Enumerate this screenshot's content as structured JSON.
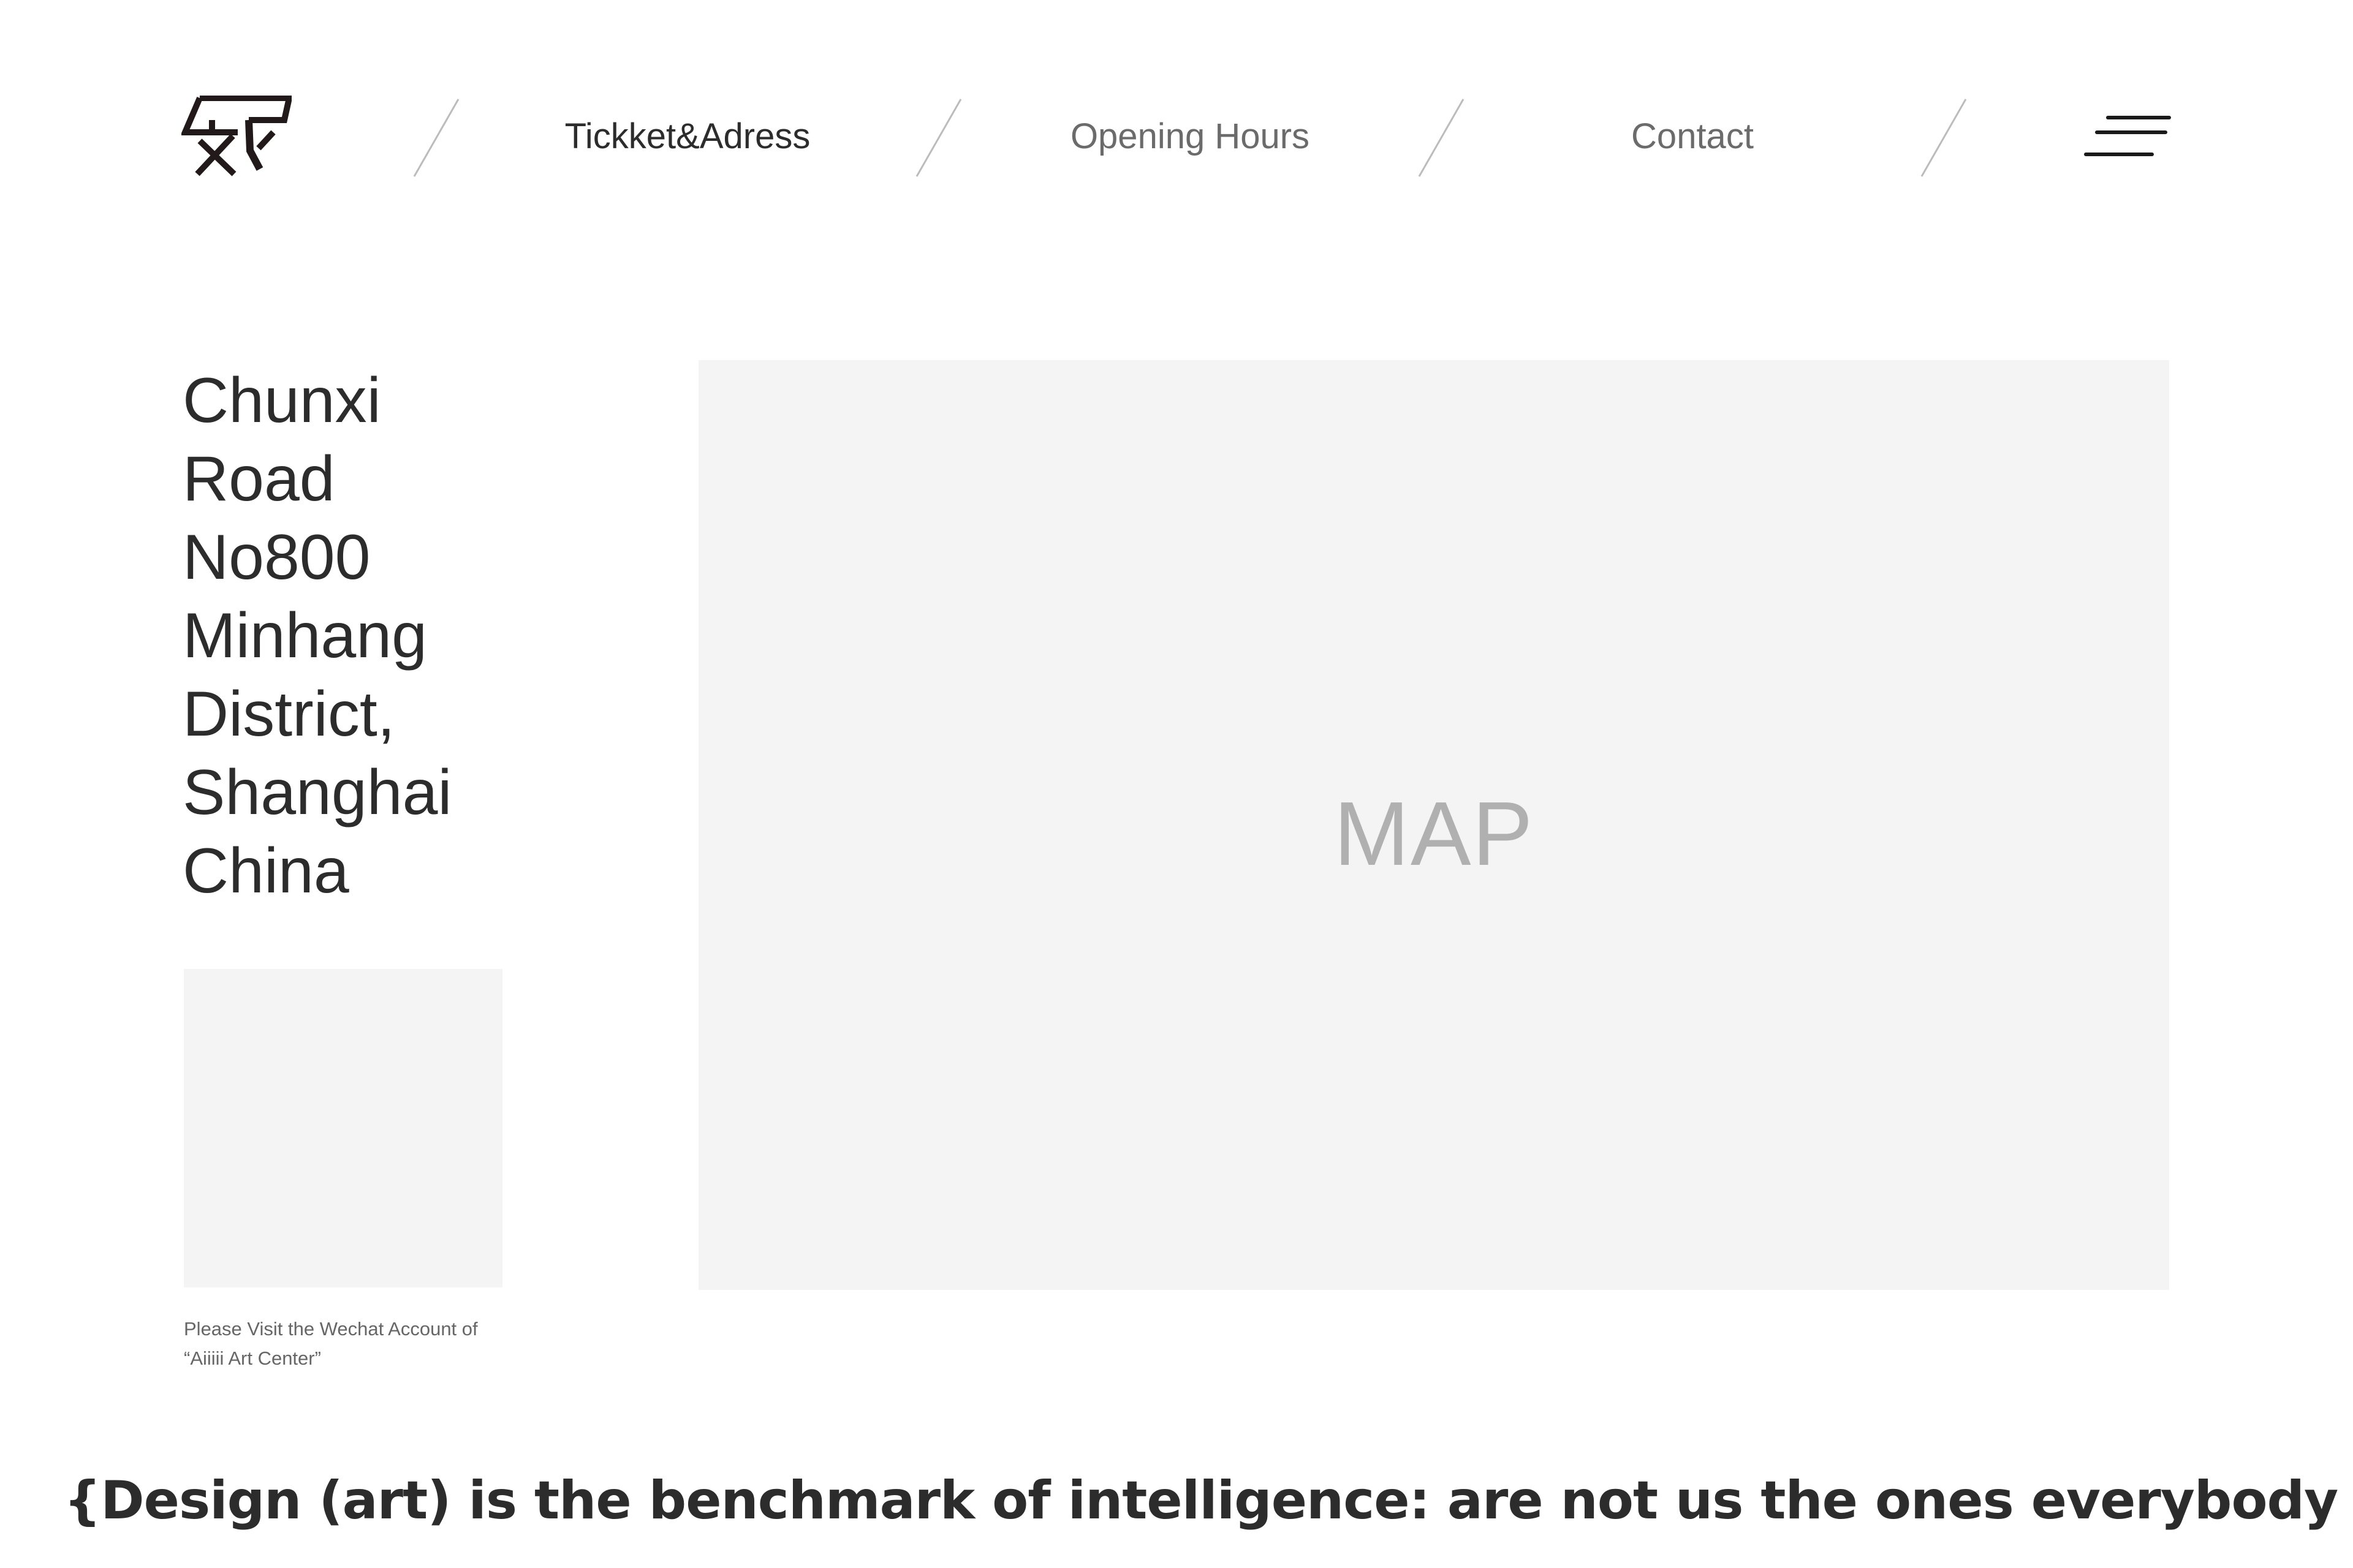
{
  "header": {
    "logo_icon": "aiiiii-art-center-logo",
    "nav": [
      {
        "label": "Tickket&Adress",
        "active": true
      },
      {
        "label": "Opening Hours",
        "active": false
      },
      {
        "label": "Contact",
        "active": false
      }
    ],
    "menu_icon": "hamburger-menu-icon"
  },
  "address": {
    "lines": [
      "Chunxi",
      "Road",
      "No800",
      "Minhang",
      "District,",
      "Shanghai",
      "China"
    ]
  },
  "wechat": {
    "caption_line1": "Please Visit the Wechat Account of",
    "caption_line2": "“Aiiiii Art Center”"
  },
  "map": {
    "label": "MAP"
  },
  "footer": {
    "quote": "{Design (art) is the benchmark of intelligence: are not us the ones everybody is waiting for?}"
  },
  "colors": {
    "text_dark": "#2c2c2c",
    "text_muted": "#6b6b6b",
    "placeholder_bg": "#f4f4f4",
    "map_label": "#b0b0b0",
    "divider": "#bcbcbc"
  }
}
